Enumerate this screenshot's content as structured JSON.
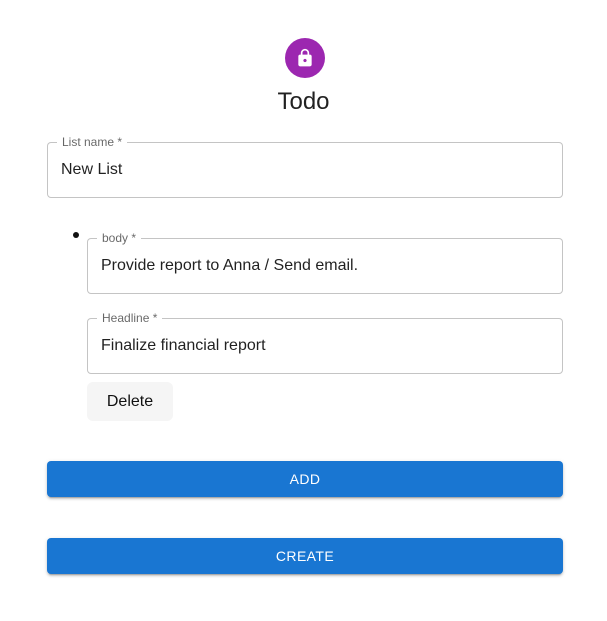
{
  "header": {
    "title": "Todo",
    "avatar_icon": "lock-icon",
    "avatar_color": "#9c27b0"
  },
  "form": {
    "list_name": {
      "label": "List name",
      "required_mark": "*",
      "value": "New List"
    },
    "items": [
      {
        "body": {
          "label": "body",
          "required_mark": "*",
          "value": "Provide report to Anna / Send email."
        },
        "headline": {
          "label": "Headline",
          "required_mark": "*",
          "value": "Finalize financial report"
        },
        "delete_label": "Delete"
      }
    ],
    "add_label": "ADD",
    "create_label": "CREATE"
  },
  "colors": {
    "primary": "#1976d2",
    "avatar": "#9c27b0"
  }
}
